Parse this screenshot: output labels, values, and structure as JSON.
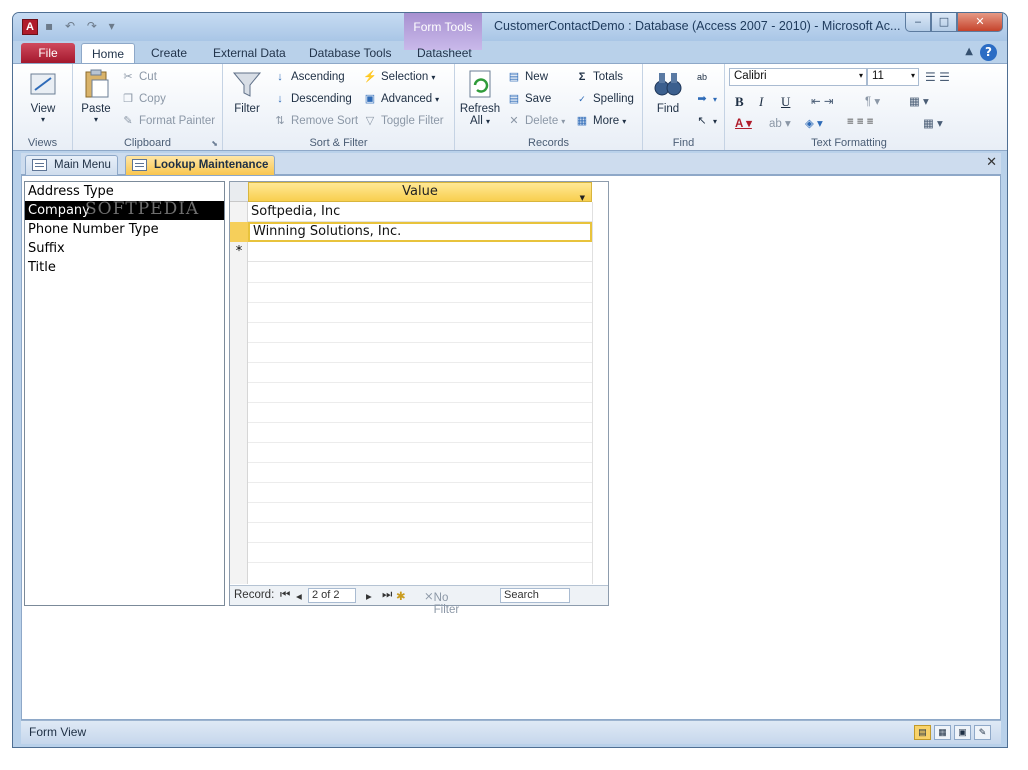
{
  "window": {
    "title": "CustomerContactDemo : Database (Access 2007 - 2010)  -  Microsoft Ac...",
    "context_tab": "Form Tools",
    "app_icon": "A",
    "minimize": "‒",
    "maximize": "□",
    "close": "✕"
  },
  "tabs": {
    "file": "File",
    "home": "Home",
    "create": "Create",
    "external": "External Data",
    "dbtools": "Database Tools",
    "datasheet": "Datasheet"
  },
  "ribbon": {
    "views": {
      "label": "Views",
      "view": "View"
    },
    "clipboard": {
      "label": "Clipboard",
      "paste": "Paste",
      "cut": "Cut",
      "copy": "Copy",
      "format_painter": "Format Painter"
    },
    "sort_filter": {
      "label": "Sort & Filter",
      "filter": "Filter",
      "ascending": "Ascending",
      "descending": "Descending",
      "remove_sort": "Remove Sort",
      "selection": "Selection",
      "advanced": "Advanced",
      "toggle_filter": "Toggle Filter"
    },
    "records": {
      "label": "Records",
      "refresh": "Refresh",
      "refresh2": "All",
      "new": "New",
      "save": "Save",
      "delete": "Delete",
      "totals": "Totals",
      "spelling": "Spelling",
      "more": "More"
    },
    "find": {
      "label": "Find",
      "find": "Find"
    },
    "text_formatting": {
      "label": "Text Formatting",
      "font": "Calibri",
      "size": "11"
    }
  },
  "doc_tabs": {
    "main_menu": "Main Menu",
    "lookup": "Lookup Maintenance"
  },
  "lookup_list": {
    "items": [
      "Address Type",
      "Company",
      "Phone Number Type",
      "Suffix",
      "Title"
    ],
    "selected": "Company",
    "watermark": "SOFTPEDIA"
  },
  "datasheet": {
    "column": "Value",
    "rows": [
      "Softpedia, Inc",
      "Winning Solutions, Inc."
    ],
    "new_row_marker": "*"
  },
  "navigation": {
    "record_label": "Record:",
    "position": "2 of 2",
    "no_filter": "No Filter",
    "search": "Search"
  },
  "status": {
    "view": "Form View"
  },
  "colors": {
    "file_tab": "#b01c2b",
    "active_doc_tab": "#f9c64f",
    "header": "#f8cf4f"
  }
}
